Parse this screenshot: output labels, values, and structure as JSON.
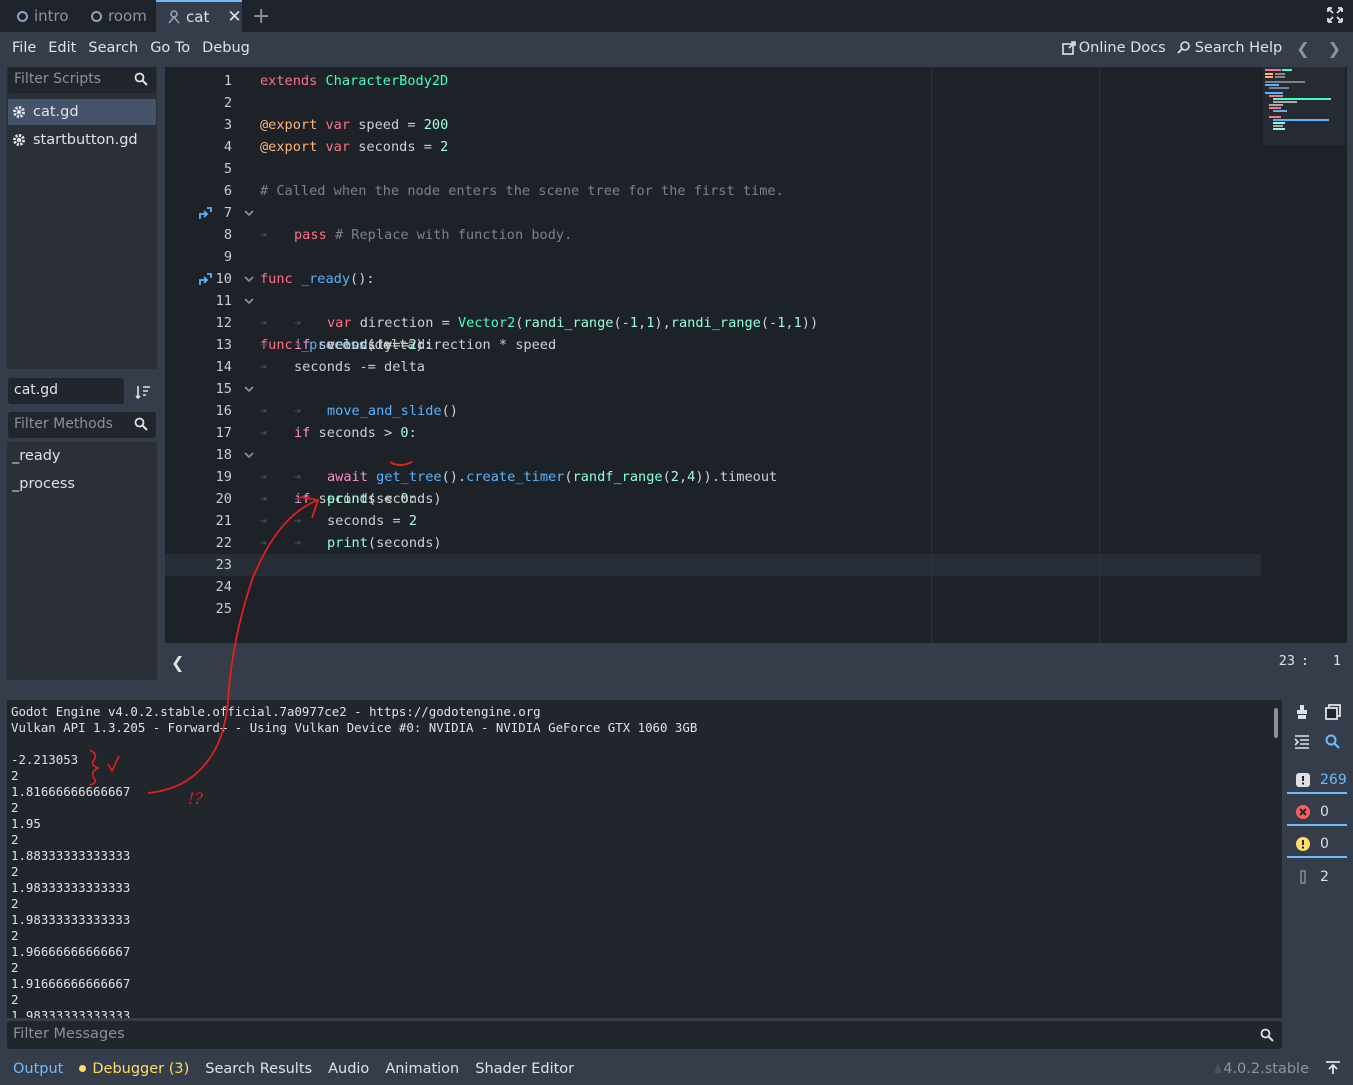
{
  "tabs": [
    {
      "label": "intro",
      "active": false
    },
    {
      "label": "room",
      "active": false
    },
    {
      "label": "cat",
      "active": true
    }
  ],
  "menu": [
    "File",
    "Edit",
    "Search",
    "Go To",
    "Debug"
  ],
  "right_menu": {
    "online_docs": "Online Docs",
    "search_help": "Search Help"
  },
  "scripts": {
    "filter_placeholder": "Filter Scripts",
    "items": [
      "cat.gd",
      "startbutton.gd"
    ],
    "current": "cat.gd"
  },
  "methods": {
    "filter_placeholder": "Filter Methods",
    "items": [
      "_ready",
      "_process"
    ]
  },
  "code_lines": [
    "extends CharacterBody2D",
    "",
    "@export var speed = 200",
    "@export var seconds = 2",
    "",
    "# Called when the node enters the scene tree for the first time.",
    "func _ready():",
    "pass # Replace with function body.",
    "",
    "func _process(delta):",
    "if seconds == 2:",
    "var direction = Vector2(randi_range(-1,1),randi_range(-1,1))",
    "velocity = direction * speed",
    "seconds -= delta",
    "if seconds > 0:",
    "move_and_slide()",
    "",
    "if seconds < 0:",
    "await get_tree().create_timer(randf_range(2,4)).timeout",
    "print(seconds)",
    "seconds = 2",
    "print(seconds)",
    "",
    "",
    ""
  ],
  "cursor": {
    "line": "23",
    "sep": ":",
    "col": "1"
  },
  "output_lines": [
    "Godot Engine v4.0.2.stable.official.7a0977ce2 - https://godotengine.org",
    "Vulkan API 1.3.205 - Forward+ - Using Vulkan Device #0: NVIDIA - NVIDIA GeForce GTX 1060 3GB",
    "",
    "-2.213053",
    "2",
    "1.81666666666667",
    "2",
    "1.95",
    "2",
    "1.88333333333333",
    "2",
    "1.98333333333333",
    "2",
    "1.98333333333333",
    "2",
    "1.96666666666667",
    "2",
    "1.91666666666667",
    "2",
    "1.98333333333333"
  ],
  "filter_messages_placeholder": "Filter Messages",
  "counters": {
    "messages": "269",
    "errors": "0",
    "warnings": "0",
    "editor": "2"
  },
  "bottom_tabs": [
    "Output",
    "Debugger (3)",
    "Search Results",
    "Audio",
    "Animation",
    "Shader Editor"
  ],
  "version": "4.0.2.stable",
  "annotations": {
    "note": "!?"
  },
  "colors": {
    "accent": "#70bafa",
    "annotation_red": "#e0201c",
    "warning": "#ffdd65"
  }
}
